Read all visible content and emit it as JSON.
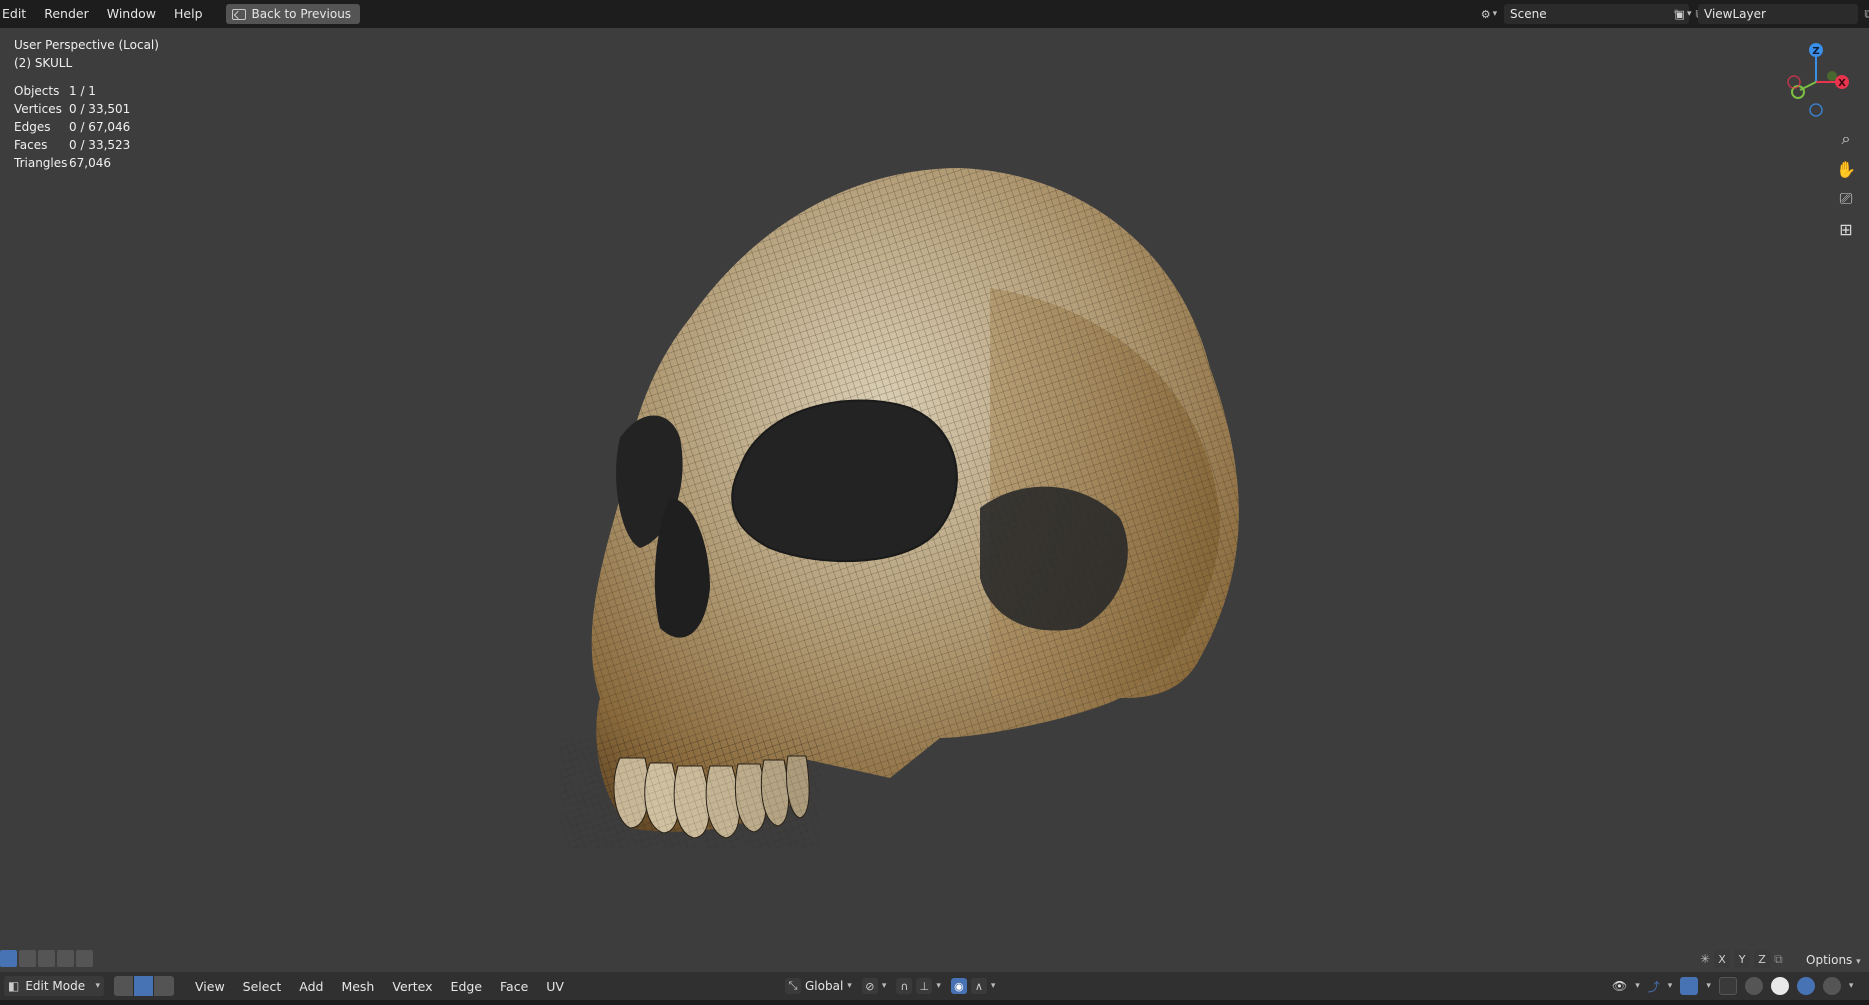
{
  "topbar": {
    "menus": [
      "Edit",
      "Render",
      "Window",
      "Help"
    ],
    "back_label": "Back to Previous",
    "scene_name": "Scene",
    "view_layer_name": "ViewLayer"
  },
  "viewport": {
    "perspective": "User Perspective (Local)",
    "object_name": "(2) SKULL",
    "stats": [
      {
        "label": "Objects",
        "value": "1 / 1"
      },
      {
        "label": "Vertices",
        "value": "0 / 33,501"
      },
      {
        "label": "Edges",
        "value": "0 / 67,046"
      },
      {
        "label": "Faces",
        "value": "0 / 33,523"
      },
      {
        "label": "Triangles",
        "value": "67,046"
      }
    ],
    "gizmo": {
      "z": "Z",
      "x": "X"
    }
  },
  "bottom_strip": {
    "axis_x": "X",
    "axis_y": "Y",
    "axis_z": "Z",
    "options_label": "Options"
  },
  "header": {
    "mode": "Edit Mode",
    "menus": [
      "View",
      "Select",
      "Add",
      "Mesh",
      "Vertex",
      "Edge",
      "Face",
      "UV"
    ],
    "transform_orientation": "Global"
  },
  "colors": {
    "background": "#3d3d3d",
    "topbar": "#1d1d1d",
    "accent": "#4772b3",
    "axis_x": "#e8354d",
    "axis_y": "#7bc043",
    "axis_z": "#3a8fe8"
  }
}
